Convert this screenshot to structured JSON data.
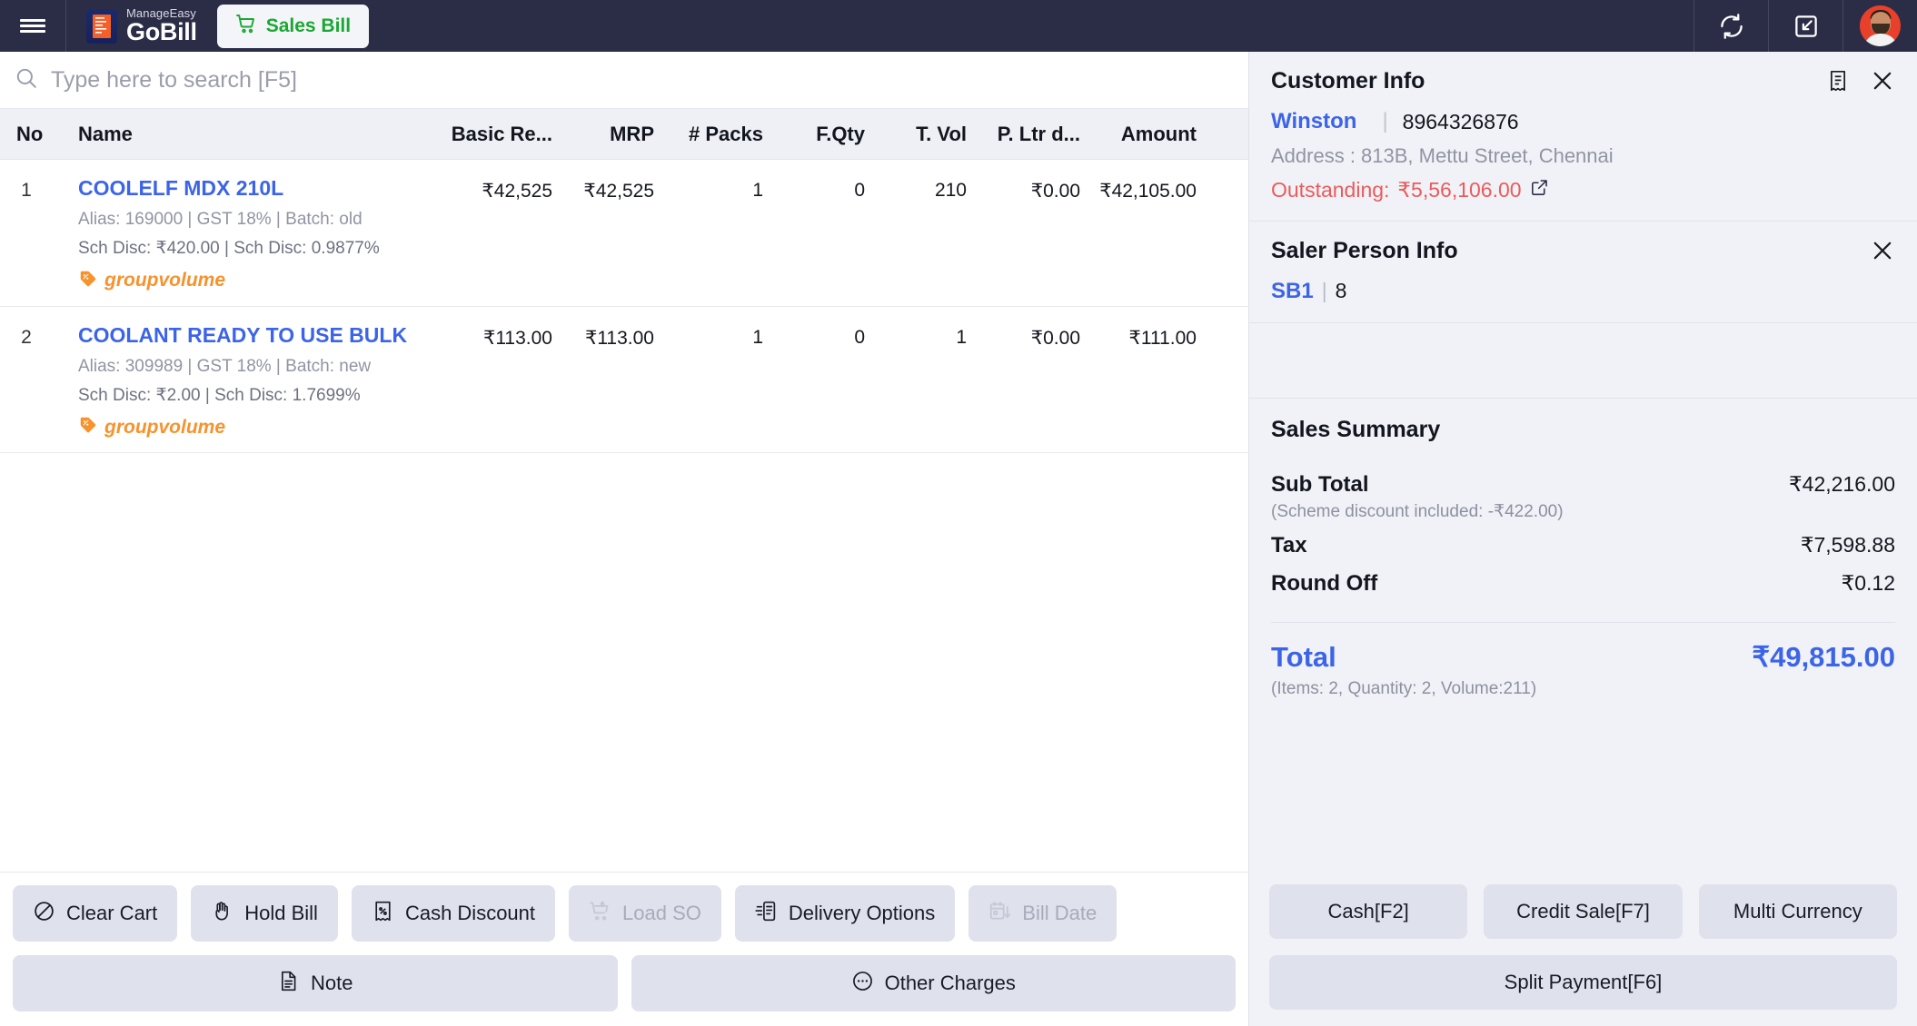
{
  "topbar": {
    "menu_icon": "hamburger-icon",
    "brand_top": "ManageEasy",
    "brand_bottom": "GoBill",
    "tab_label": "Sales Bill",
    "tab_icon": "cart-icon",
    "refresh_icon": "refresh-icon",
    "restore_icon": "restore-down-icon",
    "avatar_icon": "user-avatar",
    "accent_green": "#19a832",
    "bar_bg": "#2b2d47"
  },
  "search": {
    "placeholder": "Type here to search [F5]",
    "value": "",
    "icon": "search-icon"
  },
  "table": {
    "columns": [
      "No",
      "Name",
      "Basic Re...",
      "MRP",
      "# Packs",
      "F.Qty",
      "T. Vol",
      "P. Ltr d...",
      "Amount"
    ],
    "rows": [
      {
        "no": "1",
        "name": "COOLELF MDX 210L",
        "meta": "Alias: 169000 | GST 18% | Batch: old",
        "discount": "Sch Disc: ₹420.00 | Sch Disc: 0.9877%",
        "tag": "groupvolume",
        "basic_rate": "₹42,525",
        "mrp": "₹42,525",
        "packs": "1",
        "fqty": "0",
        "tvol": "210",
        "pltr": "₹0.00",
        "amount": "₹42,105.00"
      },
      {
        "no": "2",
        "name": "COOLANT READY TO USE BULK",
        "meta": "Alias: 309989 | GST 18% | Batch: new",
        "discount": "Sch Disc: ₹2.00 | Sch Disc: 1.7699%",
        "tag": "groupvolume",
        "basic_rate": "₹113.00",
        "mrp": "₹113.00",
        "packs": "1",
        "fqty": "0",
        "tvol": "1",
        "pltr": "₹0.00",
        "amount": "₹111.00"
      }
    ]
  },
  "left_actions": {
    "row1": [
      {
        "label": "Clear Cart",
        "icon": "no-entry-icon",
        "disabled": false
      },
      {
        "label": "Hold Bill",
        "icon": "hand-icon",
        "disabled": false
      },
      {
        "label": "Cash Discount",
        "icon": "receipt-percent-icon",
        "disabled": false
      },
      {
        "label": "Load SO",
        "icon": "cart-dollar-icon",
        "disabled": true
      },
      {
        "label": "Delivery Options",
        "icon": "delivery-note-icon",
        "disabled": false
      },
      {
        "label": "Bill Date",
        "icon": "calendar-down-icon",
        "disabled": true
      }
    ],
    "row2": [
      {
        "label": "Note",
        "icon": "document-icon",
        "disabled": false
      },
      {
        "label": "Other Charges",
        "icon": "ellipsis-circle-icon",
        "disabled": false
      }
    ]
  },
  "customer": {
    "title": "Customer Info",
    "bill_icon": "receipt-list-icon",
    "close_icon": "close-icon",
    "name": "Winston",
    "separator": "|",
    "phone": "8964326876",
    "address": "Address : 813B, Mettu Street, Chennai",
    "outstanding_label": "Outstanding:",
    "outstanding_value": "₹5,56,106.00",
    "external_icon": "external-link-icon",
    "outstanding_color": "#ea5b5b"
  },
  "saler": {
    "title": "Saler Person Info",
    "close_icon": "close-icon",
    "code": "SB1",
    "separator": "|",
    "number": "8"
  },
  "summary": {
    "title": "Sales Summary",
    "sub_total_label": "Sub Total",
    "sub_total_value": "₹42,216.00",
    "scheme_note": "(Scheme discount included: -₹422.00)",
    "tax_label": "Tax",
    "tax_value": "₹7,598.88",
    "round_off_label": "Round Off",
    "round_off_value": "₹0.12",
    "total_label": "Total",
    "total_value": "₹49,815.00",
    "total_note": "(Items: 2, Quantity: 2, Volume:211)",
    "total_color": "#3c64e8"
  },
  "payment": {
    "cash": "Cash[F2]",
    "credit": "Credit Sale[F7]",
    "multi_currency": "Multi Currency",
    "split": "Split Payment[F6]"
  }
}
